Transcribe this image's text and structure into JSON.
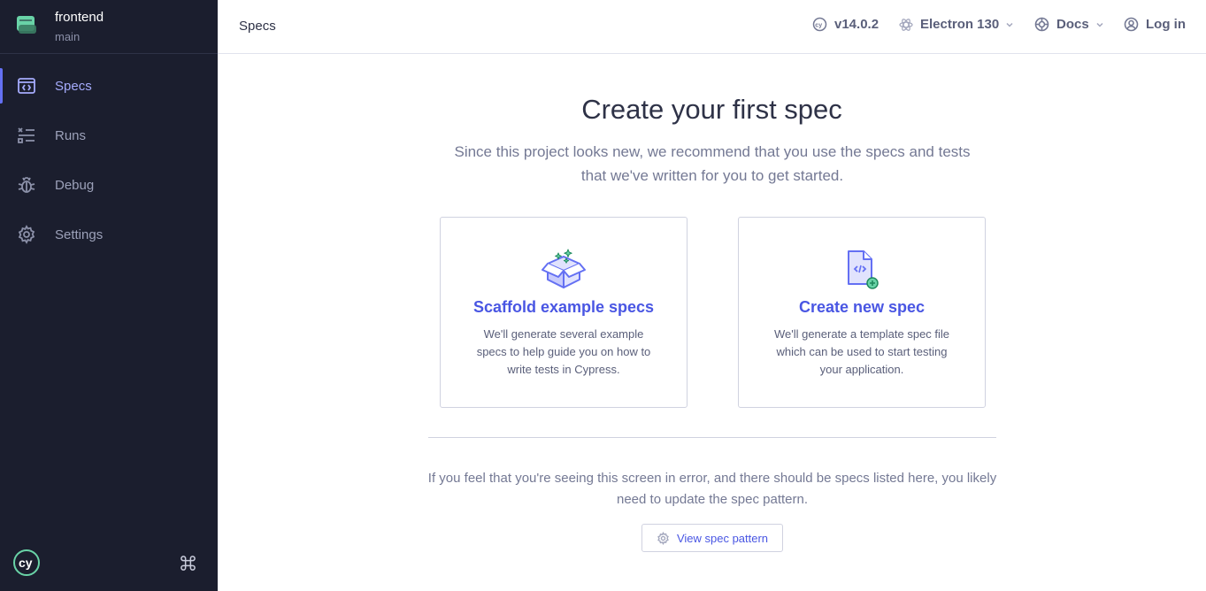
{
  "sidebar": {
    "project_name": "frontend",
    "branch": "main",
    "items": [
      {
        "label": "Specs",
        "icon": "specs-icon",
        "active": true
      },
      {
        "label": "Runs",
        "icon": "runs-icon",
        "active": false
      },
      {
        "label": "Debug",
        "icon": "bug-icon",
        "active": false
      },
      {
        "label": "Settings",
        "icon": "gear-icon",
        "active": false
      }
    ]
  },
  "header": {
    "title": "Specs",
    "version": "v14.0.2",
    "browser": "Electron 130",
    "docs": "Docs",
    "login": "Log in"
  },
  "main": {
    "title": "Create your first spec",
    "description": "Since this project looks new, we recommend that you use the specs and tests that we've written for you to get started.",
    "cards": [
      {
        "title": "Scaffold example specs",
        "description": "We'll generate several example specs to help guide you on how to write tests in Cypress.",
        "icon": "box-icon"
      },
      {
        "title": "Create new spec",
        "description": "We'll generate a template spec file which can be used to start testing your application.",
        "icon": "new-file-icon"
      }
    ],
    "error_text": "If you feel that you're seeing this screen in error, and there should be specs listed here, you likely need to update the spec pattern.",
    "view_spec_button": "View spec pattern"
  },
  "colors": {
    "sidebar_bg": "#1b1e2e",
    "accent": "#4956e3",
    "active_nav": "#a5abfc",
    "project_green": "#69d3a7"
  }
}
